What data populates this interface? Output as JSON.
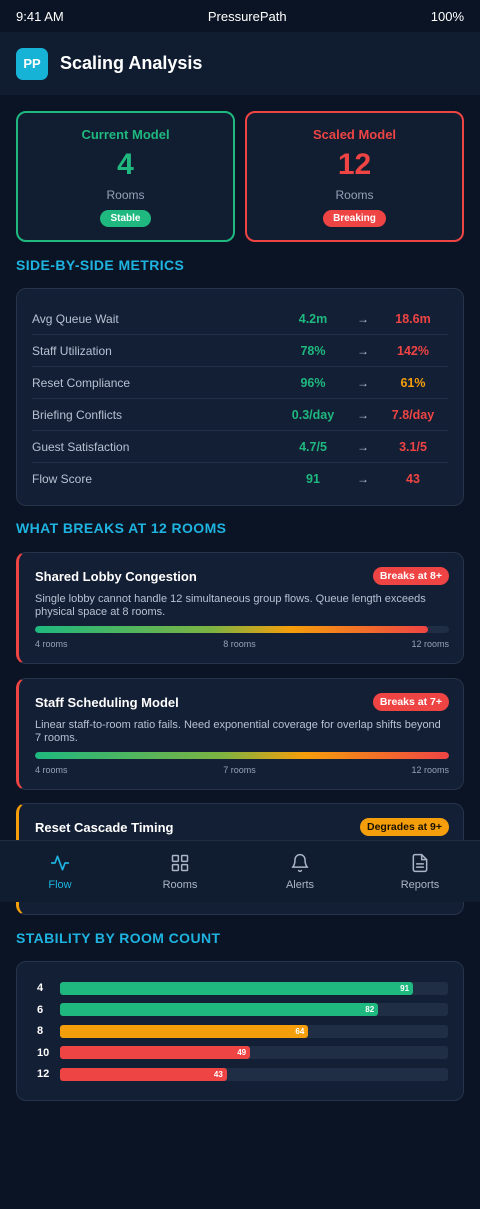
{
  "status": {
    "time": "9:41 AM",
    "carrier": "PressurePath",
    "battery": "100%"
  },
  "header": {
    "logo": "PP",
    "title": "Scaling Analysis"
  },
  "models": {
    "current": {
      "label": "Current Model",
      "number": "4",
      "unit": "Rooms",
      "badge": "Stable",
      "color": "#1fb87f"
    },
    "scaled": {
      "label": "Scaled Model",
      "number": "12",
      "unit": "Rooms",
      "badge": "Breaking",
      "color": "#ef4444"
    }
  },
  "metrics": {
    "title": "SIDE-BY-SIDE METRICS",
    "arrow": "→",
    "rows": [
      {
        "name": "Avg Queue Wait",
        "current": "4.2m",
        "scaled": "18.6m",
        "current_color": "#1fb87f",
        "scaled_color": "#ef4444"
      },
      {
        "name": "Staff Utilization",
        "current": "78%",
        "scaled": "142%",
        "current_color": "#1fb87f",
        "scaled_color": "#ef4444"
      },
      {
        "name": "Reset Compliance",
        "current": "96%",
        "scaled": "61%",
        "current_color": "#1fb87f",
        "scaled_color": "#f59e0b"
      },
      {
        "name": "Briefing Conflicts",
        "current": "0.3/day",
        "scaled": "7.8/day",
        "current_color": "#1fb87f",
        "scaled_color": "#ef4444"
      },
      {
        "name": "Guest Satisfaction",
        "current": "4.7/5",
        "scaled": "3.1/5",
        "current_color": "#1fb87f",
        "scaled_color": "#ef4444"
      },
      {
        "name": "Flow Score",
        "current": "91",
        "scaled": "43",
        "current_color": "#1fb87f",
        "scaled_color": "#ef4444"
      }
    ]
  },
  "breaks": {
    "title": "WHAT BREAKS AT 12 ROOMS",
    "cards": [
      {
        "title": "Shared Lobby Congestion",
        "pill": "Breaks at 8+",
        "pill_color": "#ef4444",
        "desc": "Single lobby cannot handle 12 simultaneous group flows. Queue length exceeds physical space at 8 rooms.",
        "progress": 0.95,
        "scale": [
          "4 rooms",
          "8 rooms",
          "12 rooms"
        ]
      },
      {
        "title": "Staff Scheduling Model",
        "pill": "Breaks at 7+",
        "pill_color": "#ef4444",
        "desc": "Linear staff-to-room ratio fails. Need exponential coverage for overlap shifts beyond 7 rooms.",
        "progress": 1.0,
        "scale": [
          "4 rooms",
          "7 rooms",
          "12 rooms"
        ]
      },
      {
        "title": "Reset Cascade Timing",
        "pill": "Degrades at 9+",
        "pill_color": "#f59e0b"
      }
    ]
  },
  "nav": [
    {
      "label": "Flow",
      "icon": "pulse-icon",
      "active": true
    },
    {
      "label": "Rooms",
      "icon": "grid-icon",
      "active": false
    },
    {
      "label": "Alerts",
      "icon": "bell-icon",
      "active": false
    },
    {
      "label": "Reports",
      "icon": "document-icon",
      "active": false
    }
  ],
  "stability": {
    "title": "STABILITY BY ROOM COUNT",
    "rows": [
      {
        "rooms": "4",
        "score": 91,
        "color": "#1fb87f"
      },
      {
        "rooms": "6",
        "score": 82,
        "color": "#1fb87f"
      },
      {
        "rooms": "8",
        "score": 64,
        "color": "#f59e0b"
      },
      {
        "rooms": "10",
        "score": 49,
        "color": "#ef4444"
      },
      {
        "rooms": "12",
        "score": 43,
        "color": "#ef4444"
      }
    ]
  }
}
